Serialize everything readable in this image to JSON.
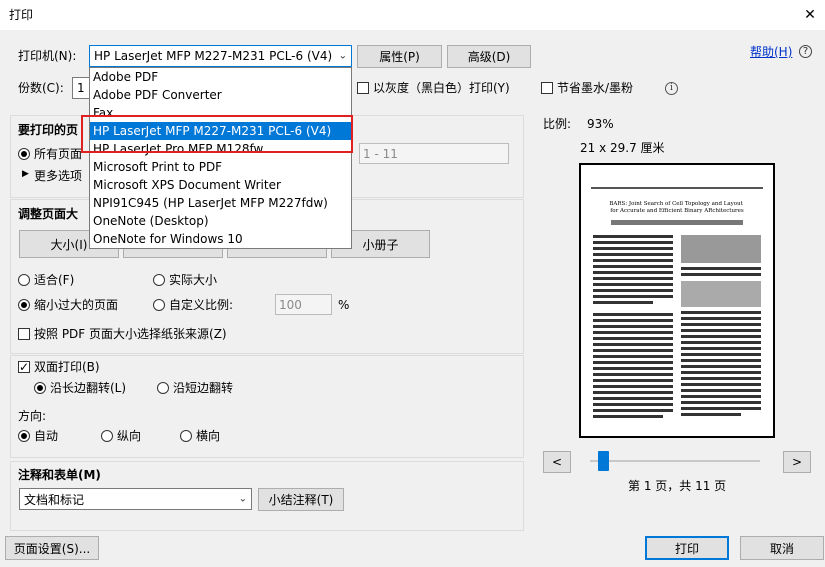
{
  "window": {
    "title": "打印"
  },
  "help": {
    "label": "帮助(H)"
  },
  "printer": {
    "label": "打印机(N):",
    "selected": "HP LaserJet MFP M227-M231 PCL-6 (V4)",
    "properties_button": "属性(P)",
    "advanced_button": "高级(D)",
    "options": [
      "Adobe PDF",
      "Adobe PDF Converter",
      "Fax",
      "HP LaserJet MFP M227-M231 PCL-6 (V4)",
      "HP LaserJet Pro MFP M128fw",
      "Microsoft Print to PDF",
      "Microsoft XPS Document Writer",
      "NPI91C945 (HP LaserJet MFP M227fdw)",
      "OneNote (Desktop)",
      "OneNote for Windows 10"
    ],
    "highlighted_index": 3
  },
  "copies": {
    "label": "份数(C):",
    "value": "1"
  },
  "grayscale": {
    "label": "以灰度（黑白色）打印(Y)",
    "checked": false
  },
  "save_ink": {
    "label": "节省墨水/墨粉",
    "checked": false
  },
  "pages_to_print": {
    "title": "要打印的页",
    "all_label": "所有页面",
    "range_value": "1 - 11",
    "more_options": "更多选项"
  },
  "sizing": {
    "title": "调整页面大",
    "tabs": [
      "大小(I)",
      "",
      "",
      "小册子"
    ],
    "fit": "适合(F)",
    "actual_size": "实际大小",
    "shrink": "缩小过大的页面",
    "custom_scale": "自定义比例:",
    "scale_value": "100",
    "scale_unit": "%",
    "paper_source": "按照 PDF 页面大小选择纸张来源(Z)"
  },
  "duplex": {
    "label": "双面打印(B)",
    "checked": true,
    "long_edge": "沿长边翻转(L)",
    "short_edge": "沿短边翻转"
  },
  "orientation": {
    "title": "方向:",
    "auto": "自动",
    "portrait": "纵向",
    "landscape": "横向"
  },
  "comments": {
    "title": "注释和表单(M)",
    "selected": "文档和标记",
    "summarize_button": "小结注释(T)"
  },
  "preview": {
    "scale_label": "比例:",
    "scale_value": "93%",
    "paper_size": "21 x 29.7 厘米",
    "paper_title": "BARS: Joint Search of Cell Topology and Layout for Accurate and Efficient Binary ARchitectures",
    "page_info": "第 1 页，共 11 页",
    "prev_button": "<",
    "next_button": ">",
    "slider_fraction": 0.0
  },
  "footer": {
    "page_setup_button": "页面设置(S)...",
    "print_button": "打印",
    "cancel_button": "取消"
  },
  "colors": {
    "accent": "#0078d7",
    "highlight_box": "#e02020"
  }
}
